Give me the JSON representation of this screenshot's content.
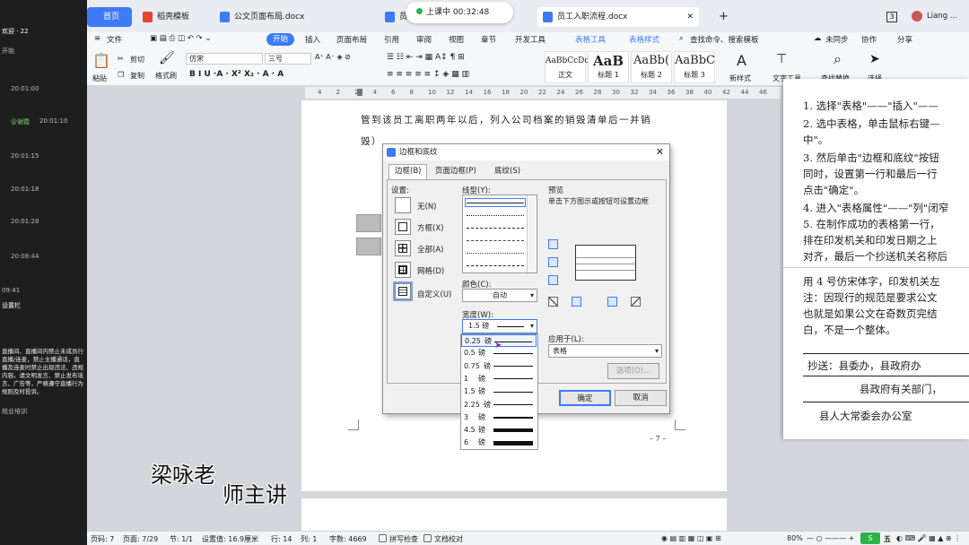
{
  "chat": {
    "header": "欢迎 · 22",
    "header2": "开始",
    "times": [
      "20:01:00",
      "20:01:10",
      "20:01:15",
      "20:01:18",
      "20:01:28",
      "20:08:44",
      "09:41"
    ],
    "highlight": "@谢霞",
    "link": "设置栏",
    "notice": "直播间、直播间内禁止未成员行直播/连麦，禁止主播通话，直播及连麦时禁止出现违法、违规内容。请文明发言、禁止发布谣言、广告等，严格遵守直播行为规则及时投诉。",
    "footer": "就业培训"
  },
  "tabs": {
    "home": "首页",
    "items": [
      {
        "label": "稻壳模板",
        "color": "#e6452e"
      },
      {
        "label": "公文页面布局.docx",
        "color": "#3e7bf6"
      },
      {
        "label": "员",
        "color": "#3e7bf6"
      },
      {
        "label": "员工入职流程.docx",
        "color": "#3e7bf6"
      }
    ],
    "new_tab": "+",
    "badge": "3",
    "user": "Liang ..."
  },
  "timer": {
    "label": "上课中 00:32:48"
  },
  "menu": {
    "file": "文件",
    "items": [
      "开始",
      "插入",
      "页面布局",
      "引用",
      "审阅",
      "视图",
      "章节",
      "开发工具"
    ],
    "context": [
      "表格工具",
      "表格样式"
    ],
    "search": "查找命令、搜索模板",
    "unsaved": "未同步",
    "collab": "协作",
    "share": "分享"
  },
  "ribbon": {
    "paste": "粘贴",
    "cut": "剪切",
    "copy": "复制",
    "format_brush": "格式刷",
    "font": "仿宋",
    "size": "三号",
    "styles": [
      {
        "sample": "AaBbCcDd",
        "label": "正文"
      },
      {
        "sample": "AaB",
        "label": "标题 1"
      },
      {
        "sample": "AaBb(",
        "label": "标题 2"
      },
      {
        "sample": "AaBbC",
        "label": "标题 3"
      }
    ],
    "new_style": "新样式",
    "text_tools": "文字工具",
    "find_replace": "查找替换",
    "select": "选择"
  },
  "ruler": {
    "ticks": [
      "4",
      "2",
      "2",
      "4",
      "6",
      "8",
      "10",
      "12",
      "14",
      "16",
      "18",
      "20",
      "22",
      "24",
      "26",
      "28",
      "30",
      "32",
      "34",
      "36",
      "38",
      "40",
      "42",
      "44",
      "46"
    ]
  },
  "document": {
    "line1": "管到该员工离职两年以后，列入公司档案的销毁清单后一并销",
    "line2": "毁）",
    "page_number": "– 7 –"
  },
  "dialog": {
    "title": "边框和底纹",
    "close": "✕",
    "tabs": [
      "边框(B)",
      "页面边框(P)",
      "底纹(S)"
    ],
    "settings_label": "设置:",
    "settings": [
      "无(N)",
      "方框(X)",
      "全部(A)",
      "网格(D)",
      "自定义(U)"
    ],
    "line_style_label": "线型(Y):",
    "color_label": "颜色(C):",
    "color_value": "自动",
    "width_label": "宽度(W):",
    "width_value": "1.5  磅",
    "width_options": [
      {
        "value": "0.25",
        "unit": "磅",
        "weight": 0.25
      },
      {
        "value": "0.5",
        "unit": "磅",
        "weight": 0.5
      },
      {
        "value": "0.75",
        "unit": "磅",
        "weight": 0.75
      },
      {
        "value": "1",
        "unit": "磅",
        "weight": 1
      },
      {
        "value": "1.5",
        "unit": "磅",
        "weight": 1.5
      },
      {
        "value": "2.25",
        "unit": "磅",
        "weight": 2.25
      },
      {
        "value": "3",
        "unit": "磅",
        "weight": 3
      },
      {
        "value": "4.5",
        "unit": "磅",
        "weight": 4.5
      },
      {
        "value": "6",
        "unit": "磅",
        "weight": 6
      }
    ],
    "preview_label": "预览",
    "preview_hint": "单击下方图示或按钮可设置边框",
    "apply_label": "应用于(L):",
    "apply_value": "表格",
    "options": "选项(O)...",
    "ok": "确定",
    "cancel": "取消"
  },
  "right_panel": {
    "lines": [
      "1. 选择\"表格\"——\"插入\"——",
      "2. 选中表格，单击鼠标右键—",
      "中\"。",
      "3. 然后单击\"边框和底纹\"按钮",
      "同时，设置第一行和最后一行",
      "点击\"确定\"。",
      "4. 进入\"表格属性\"——\"列\"闭窄",
      "5. 在制作成功的表格第一行，",
      "排在印发机关和印发日期之上",
      "对齐，最后一个抄送机关名称后",
      "用 4 号仿宋体字，印发机关左",
      "注：因现行的规范是要求公文",
      "也就是如果公文在奇数页完结",
      "白，不是一个整体。"
    ],
    "cc_line1": "抄送：县委办，县政府办",
    "cc_line2": "县政府有关部门，",
    "cc_line3": "县人大常委会办公室"
  },
  "watermark": {
    "part1": "梁咏老",
    "part2": "师主讲"
  },
  "status": {
    "page": "页码: 7",
    "pages": "页面: 7/29",
    "section": "节: 1/1",
    "position": "设置值: 16.9厘米",
    "line": "行: 14",
    "col": "列: 1",
    "words": "字数: 4669",
    "spell": "拼写检查",
    "proof": "文档校对",
    "zoom": "80%",
    "ime": "五"
  }
}
